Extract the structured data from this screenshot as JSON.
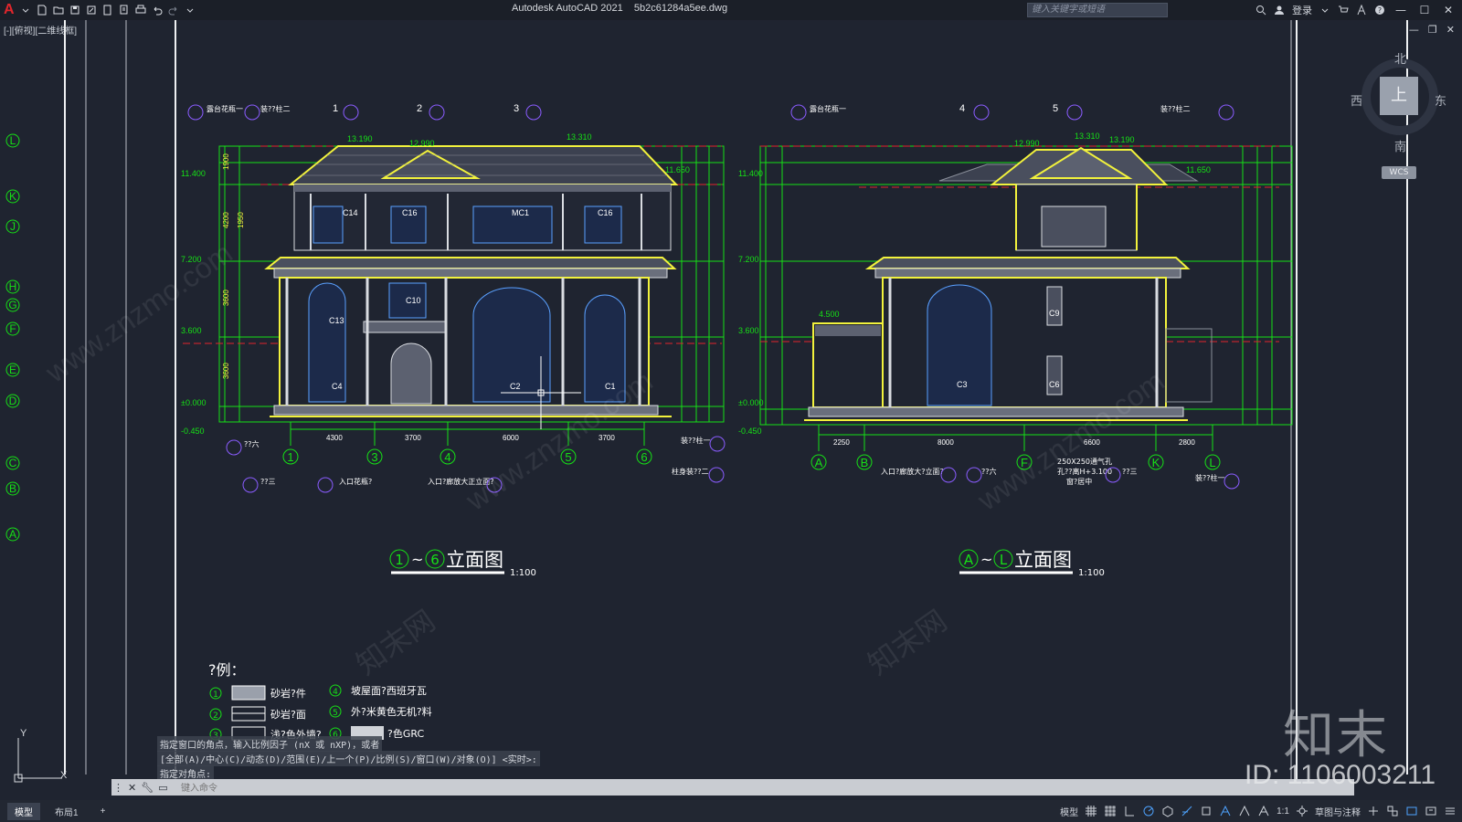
{
  "titlebar": {
    "app": "A",
    "title": "Autodesk AutoCAD 2021    5b2c61284a5ee.dwg",
    "search_placeholder": "键入关键字或短语",
    "login": "登录"
  },
  "viewport": {
    "label": "[-][俯视][二维线框]"
  },
  "compass": {
    "north": "北",
    "south": "南",
    "east": "东",
    "west": "西",
    "top": "上",
    "wcs": "WCS"
  },
  "grid_left": [
    "L",
    "K",
    "J",
    "H",
    "G",
    "F",
    "E",
    "D",
    "C",
    "B",
    "A"
  ],
  "elev1": {
    "title_axis_a": "1",
    "title_tilde": "~",
    "title_axis_b": "6",
    "title_text": "立面图",
    "scale": "1:100",
    "levels_left": [
      "11.400",
      "7.200",
      "3.600",
      "±0.000",
      "-0.450"
    ],
    "levels_right": [
      "11.650"
    ],
    "roof_levels": [
      "13.190",
      "12.990",
      "13.310"
    ],
    "windows": [
      "C14",
      "C16",
      "MC1",
      "C16",
      "C10",
      "C13",
      "C4",
      "C2",
      "C1"
    ],
    "dims_bottom": [
      "4300",
      "3700",
      "6000",
      "3700"
    ],
    "axes_bottom": [
      "1",
      "3",
      "4",
      "5",
      "6"
    ],
    "axes_top": [
      "1",
      "2",
      "3"
    ],
    "callouts_top": [
      "露台花瓶一",
      "装??柱二"
    ],
    "callouts_bottom": [
      "??六",
      "??三",
      "入口花瓶?",
      "入口?廊放大正立面?",
      "装??柱一",
      "柱身装??二"
    ],
    "dims_side": [
      "1900",
      "4200",
      "1950",
      "3600",
      "3600"
    ]
  },
  "elev2": {
    "title_axis_a": "A",
    "title_tilde": "~",
    "title_axis_b": "L",
    "title_text": "立面图",
    "scale": "1:100",
    "levels_left": [
      "11.400",
      "7.200",
      "3.600",
      "±0.000",
      "-0.450"
    ],
    "levels_right": [
      "11.650",
      "4.500"
    ],
    "roof_levels": [
      "12.990",
      "13.310",
      "13.190"
    ],
    "windows": [
      "C9",
      "C3",
      "C6"
    ],
    "dims_bottom": [
      "2250",
      "8000",
      "6600",
      "2800"
    ],
    "axes_bottom": [
      "A",
      "B",
      "F",
      "K",
      "L"
    ],
    "axes_top": [
      "4",
      "5"
    ],
    "callouts_top": [
      "露台花瓶一",
      "装??柱二"
    ],
    "callouts_bottom": [
      "入口?廊放大?立面?",
      "??六",
      "??三",
      "装??柱一"
    ],
    "vent_note": [
      "250X250通气孔",
      "孔??离H+3.100",
      "窗?居中"
    ]
  },
  "legend": {
    "title": "?例：",
    "items": [
      {
        "num": "1",
        "label": "砂岩?件"
      },
      {
        "num": "2",
        "label": "砂岩?面"
      },
      {
        "num": "3",
        "label": "浅?色外墙?"
      },
      {
        "num": "4",
        "label": "坡屋面?西班牙瓦"
      },
      {
        "num": "5",
        "label": "外?米黄色无机?料"
      },
      {
        "num": "6",
        "label": "?色GRC"
      }
    ]
  },
  "command": {
    "history": [
      "指定窗口的角点，输入比例因子 (nX 或 nXP)，或者",
      "[全部(A)/中心(C)/动态(D)/范围(E)/上一个(P)/比例(S)/窗口(W)/对象(O)] <实时>:",
      "指定对角点:"
    ],
    "placeholder": "键入命令"
  },
  "statusbar": {
    "tabs": [
      "模型",
      "布局1"
    ],
    "add": "+",
    "model": "模型",
    "scale": "1:1",
    "workspace": "草图与注释"
  },
  "ucs": {
    "y": "Y",
    "x": "X"
  },
  "watermark": {
    "logo": "知末",
    "id": "ID: 1106003211",
    "site": "www.znzmo.com",
    "brand": "知末网"
  },
  "colors": {
    "background": "#1f2430",
    "green": "#16e016",
    "yellow": "#f2f23c",
    "red": "#e0242c",
    "blue": "#4aa0ff",
    "purple": "#8a5cff"
  }
}
